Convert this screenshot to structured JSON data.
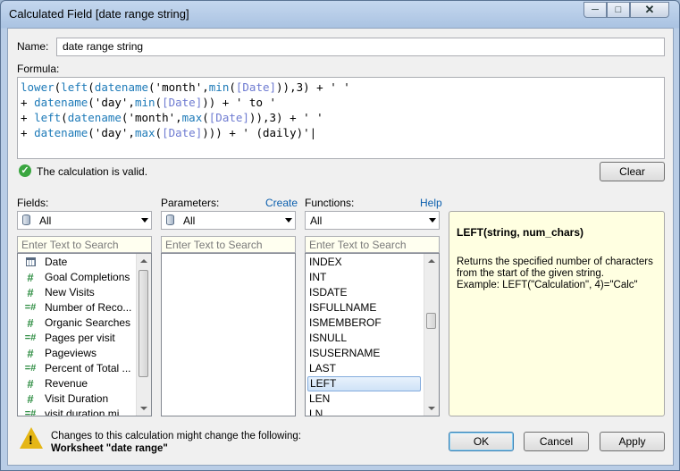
{
  "window": {
    "title": "Calculated Field [date range string]"
  },
  "name_label": "Name:",
  "name_value": "date range string",
  "formula_label": "Formula:",
  "validation": "The calculation is valid.",
  "clear_label": "Clear",
  "fields": {
    "label": "Fields:",
    "filter": "All",
    "search_placeholder": "Enter Text to Search",
    "items": [
      {
        "icon": "calendar-icon",
        "label": "Date"
      },
      {
        "icon": "hash",
        "label": "Goal Completions"
      },
      {
        "icon": "hash",
        "label": "New Visits"
      },
      {
        "icon": "calc-hash",
        "label": "Number of Reco..."
      },
      {
        "icon": "hash",
        "label": "Organic Searches"
      },
      {
        "icon": "calc-hash",
        "label": "Pages per visit"
      },
      {
        "icon": "hash",
        "label": "Pageviews"
      },
      {
        "icon": "calc-hash",
        "label": "Percent of Total ..."
      },
      {
        "icon": "hash",
        "label": "Revenue"
      },
      {
        "icon": "hash",
        "label": "Visit Duration"
      },
      {
        "icon": "calc-hash",
        "label": "visit duration mi..."
      }
    ]
  },
  "parameters": {
    "label": "Parameters:",
    "create_label": "Create",
    "filter": "All",
    "search_placeholder": "Enter Text to Search"
  },
  "functions": {
    "label": "Functions:",
    "help_label": "Help",
    "filter": "All",
    "search_placeholder": "Enter Text to Search",
    "items": [
      "INDEX",
      "INT",
      "ISDATE",
      "ISFULLNAME",
      "ISMEMBEROF",
      "ISNULL",
      "ISUSERNAME",
      "LAST",
      "LEFT",
      "LEN",
      "LN"
    ],
    "selected": "LEFT"
  },
  "description": {
    "signature": "LEFT(string, num_chars)",
    "line1": "Returns the specified number of characters",
    "line2": "from the start of the given string.",
    "line3": "Example: LEFT(\"Calculation\", 4)=\"Calc\""
  },
  "warning": {
    "line1": "Changes to this calculation might change the following:",
    "line2": "Worksheet \"date range\""
  },
  "buttons": {
    "ok": "OK",
    "cancel": "Cancel",
    "apply": "Apply"
  }
}
